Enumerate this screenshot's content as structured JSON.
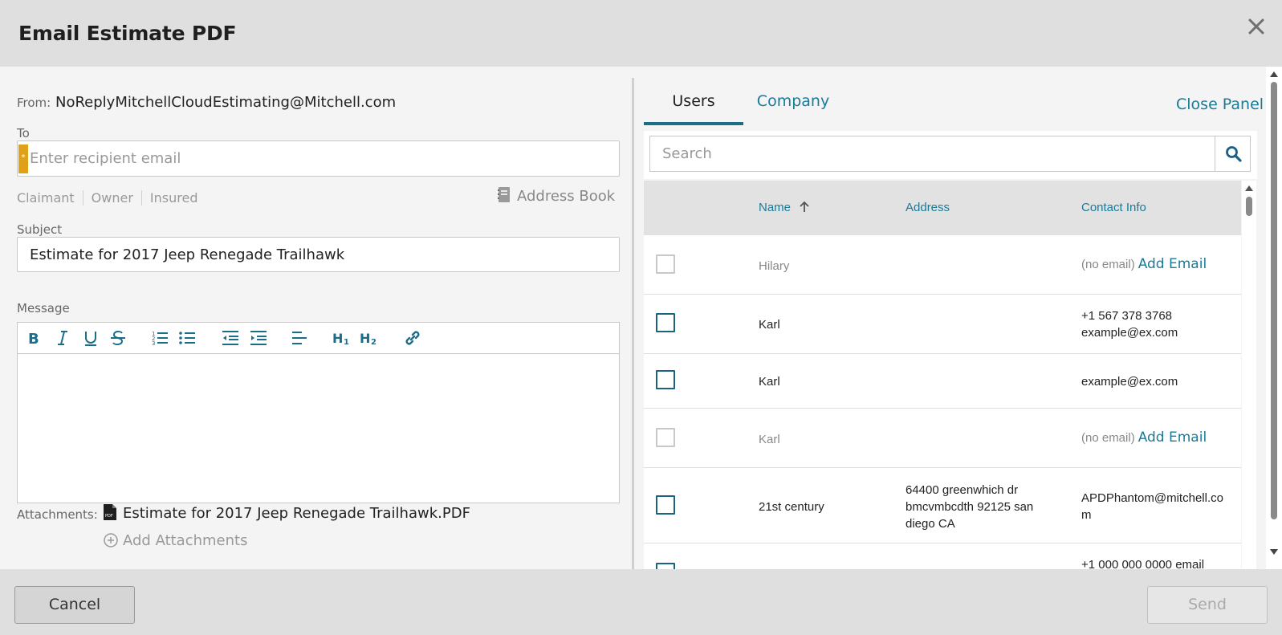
{
  "dialog": {
    "title": "Email Estimate PDF"
  },
  "form": {
    "from_label": "From:",
    "from_value": "NoReplyMitchellCloudEstimating@Mitchell.com",
    "to_label": "To",
    "to_placeholder": "Enter recipient email",
    "required_marker": "*",
    "quick_recipients": [
      "Claimant",
      "Owner",
      "Insured"
    ],
    "address_book_label": "Address Book",
    "subject_label": "Subject",
    "subject_value": "Estimate for 2017 Jeep Renegade Trailhawk",
    "message_label": "Message",
    "attachments_label": "Attachments:",
    "attachment_file": "Estimate for 2017 Jeep Renegade Trailhawk.PDF",
    "add_attachments_label": "Add Attachments"
  },
  "panel": {
    "tabs": [
      "Users",
      "Company"
    ],
    "active_tab": "Users",
    "close_panel_label": "Close Panel",
    "search_placeholder": "Search",
    "columns": {
      "name": "Name",
      "address": "Address",
      "contact": "Contact Info"
    },
    "sort_indicator": "↑",
    "rows": [
      {
        "name": "Hilary",
        "address": "",
        "contact": "",
        "no_email": "(no email)",
        "add_email": "Add Email",
        "enabled": false
      },
      {
        "name": "Karl",
        "address": "",
        "contact_line1": "+1 567 378 3768",
        "contact_line2": "example@ex.com",
        "enabled": true
      },
      {
        "name": "Karl",
        "address": "",
        "contact_line1": "example@ex.com",
        "enabled": true
      },
      {
        "name": "Karl",
        "address": "",
        "no_email": "(no email)",
        "add_email": "Add Email",
        "enabled": false
      },
      {
        "name": "21st century",
        "address": "64400 greenwhich dr bmcvmbcdth 92125 san diego CA",
        "contact_line1": "APDPhantom@mitchell.com",
        "enabled": true
      },
      {
        "name": "",
        "address": "",
        "contact_line1": "+1 000 000 0000 email",
        "enabled": true
      }
    ]
  },
  "footer": {
    "cancel_label": "Cancel",
    "send_label": "Send"
  },
  "colors": {
    "accent": "#1a7a9a",
    "required": "#e0a11a",
    "header_bg": "#dfdfdf"
  }
}
